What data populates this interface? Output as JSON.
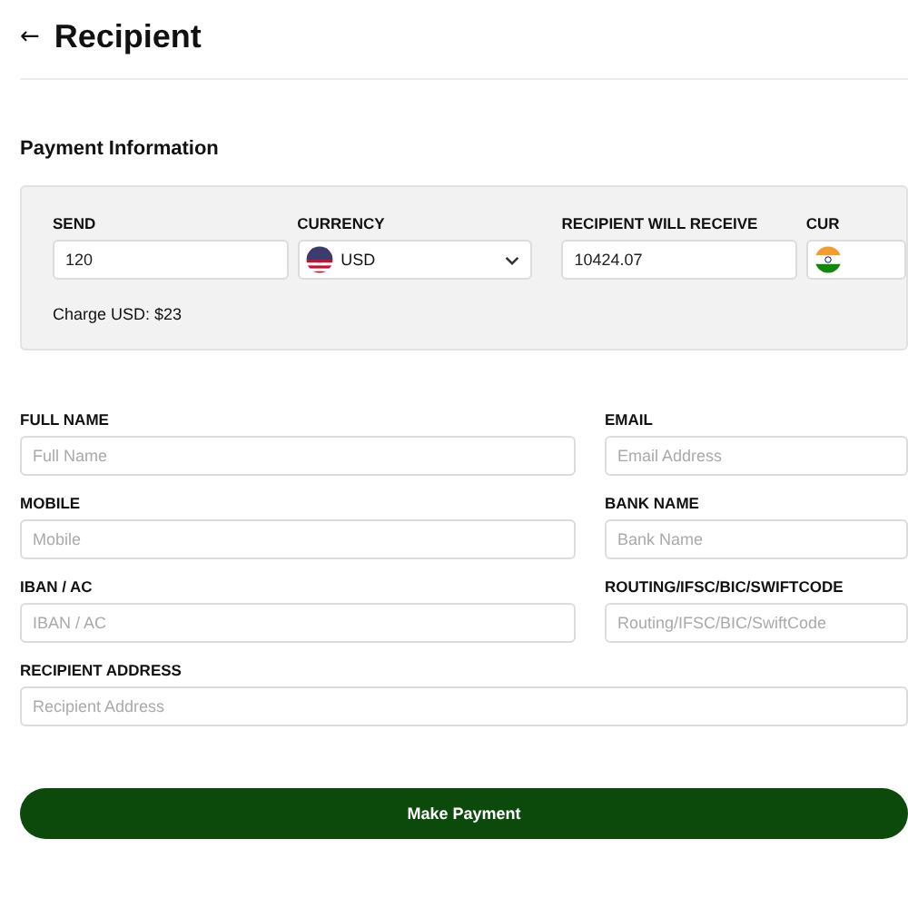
{
  "header": {
    "back": "←",
    "title": "Recipient"
  },
  "section_title": "Payment Information",
  "payment": {
    "send": {
      "label": "SEND",
      "value": "120"
    },
    "currency": {
      "label": "CURRENCY",
      "value": "USD"
    },
    "receive": {
      "label": "RECIPIENT WILL RECEIVE",
      "value": "10424.07"
    },
    "currency_2": {
      "label": "CUR"
    },
    "charge": "Charge USD: $23"
  },
  "fields": [
    {
      "label": "FULL NAME",
      "placeholder": "Full Name"
    },
    {
      "label": "EMAIL",
      "placeholder": "Email Address"
    },
    {
      "label": "MOBILE",
      "placeholder": "Mobile"
    },
    {
      "label": "BANK NAME",
      "placeholder": "Bank Name"
    },
    {
      "label": "IBAN / AC",
      "placeholder": "IBAN / AC"
    },
    {
      "label": "ROUTING/IFSC/BIC/SWIFTCODE",
      "placeholder": "Routing/IFSC/BIC/SwiftCode"
    },
    {
      "label": "RECIPIENT ADDRESS",
      "placeholder": "Recipient Address",
      "wide": true
    }
  ],
  "submit": "Make Payment"
}
